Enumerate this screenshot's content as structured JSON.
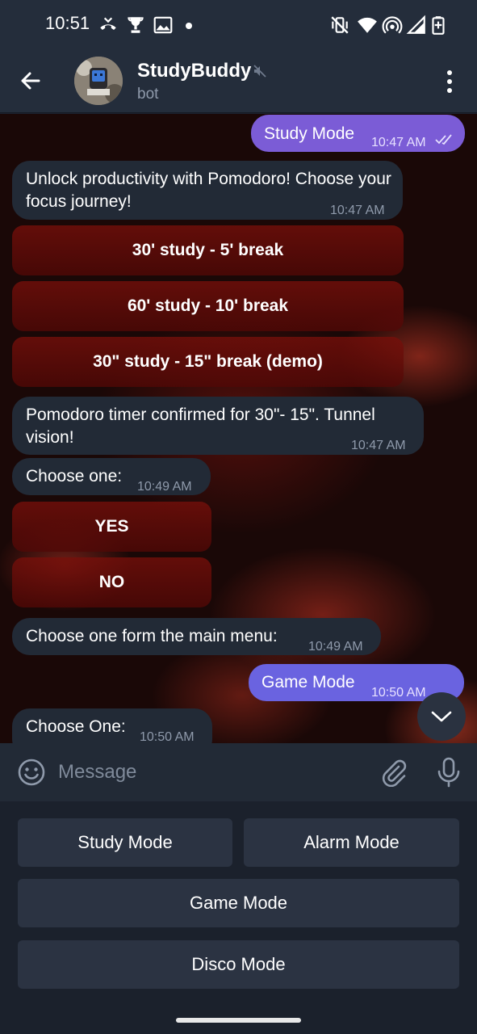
{
  "status": {
    "time": "10:51",
    "icons": [
      "missed-call-icon",
      "trophy-icon",
      "gallery-icon",
      "dot-icon",
      "vibrate-off-icon",
      "wifi-icon",
      "hotspot-icon",
      "signal-icon",
      "battery-icon"
    ]
  },
  "header": {
    "title": "StudyBuddy",
    "subtitle": "bot",
    "muted": true
  },
  "messages": [
    {
      "dir": "out",
      "text": "Study Mode",
      "time": "10:47 AM",
      "read": true
    },
    {
      "dir": "in",
      "text": "Unlock productivity with Pomodoro! Choose your focus journey!",
      "time": "10:47 AM",
      "buttons": [
        "30' study - 5' break",
        "60' study - 10' break",
        "30\" study - 15\" break (demo)"
      ]
    },
    {
      "dir": "in",
      "text": "Pomodoro timer confirmed for 30\"- 15\". Tunnel vision!",
      "time": "10:47 AM"
    },
    {
      "dir": "in",
      "text": "Choose one:",
      "time": "10:49 AM",
      "buttons": [
        "YES",
        "NO"
      ]
    },
    {
      "dir": "in",
      "text": "Choose one form the main menu:",
      "time": "10:49 AM"
    },
    {
      "dir": "out",
      "text": "Game Mode",
      "time": "10:50 AM",
      "read": true
    },
    {
      "dir": "in",
      "text": "Choose One:",
      "time": "10:50 AM"
    }
  ],
  "composer": {
    "placeholder": "Message"
  },
  "reply_keyboard": {
    "study": "Study Mode",
    "alarm": "Alarm Mode",
    "game": "Game Mode",
    "disco": "Disco Mode"
  },
  "colors": {
    "header_bg": "#242d3b",
    "incoming_bubble": "#222a36",
    "outgoing_bubble": "#7b5cd6",
    "keyboard_button": "#2b3342"
  }
}
